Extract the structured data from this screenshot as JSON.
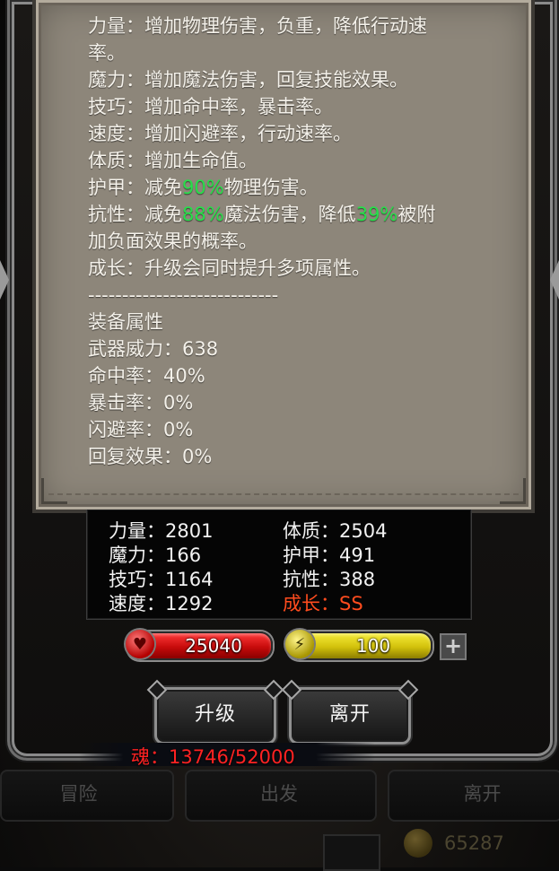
{
  "description": {
    "lines": [
      {
        "parts": [
          {
            "t": "力量：增加物理伤害，负重，降低行动速"
          }
        ]
      },
      {
        "parts": [
          {
            "t": "率。"
          }
        ]
      },
      {
        "parts": [
          {
            "t": "魔力：增加魔法伤害，回复技能效果。"
          }
        ]
      },
      {
        "parts": [
          {
            "t": "技巧：增加命中率，暴击率。"
          }
        ]
      },
      {
        "parts": [
          {
            "t": "速度：增加闪避率，行动速率。"
          }
        ]
      },
      {
        "parts": [
          {
            "t": "体质：增加生命值。"
          }
        ]
      },
      {
        "parts": [
          {
            "t": "护甲：减免"
          },
          {
            "t": "90%",
            "green": true
          },
          {
            "t": "物理伤害。"
          }
        ]
      },
      {
        "parts": [
          {
            "t": "抗性：减免"
          },
          {
            "t": "88%",
            "green": true
          },
          {
            "t": "魔法伤害，降低"
          },
          {
            "t": "39%",
            "green": true
          },
          {
            "t": "被附"
          }
        ]
      },
      {
        "parts": [
          {
            "t": "加负面效果的概率。"
          }
        ]
      },
      {
        "parts": [
          {
            "t": "成长：升级会同时提升多项属性。"
          }
        ]
      },
      {
        "parts": [
          {
            "t": "----------------------------"
          }
        ]
      },
      {
        "parts": [
          {
            "t": "装备属性"
          }
        ]
      },
      {
        "parts": [
          {
            "t": "武器威力：638"
          }
        ]
      },
      {
        "parts": [
          {
            "t": "命中率：40%"
          }
        ]
      },
      {
        "parts": [
          {
            "t": "暴击率：0%"
          }
        ]
      },
      {
        "parts": [
          {
            "t": "闪避率：0%"
          }
        ]
      },
      {
        "parts": [
          {
            "t": "回复效果：0%"
          }
        ]
      }
    ],
    "highlight_color": "#26e04a"
  },
  "stats": {
    "strength": "力量：2801",
    "magic": "魔力：166",
    "skill": "技巧：1164",
    "speed": "速度：1292",
    "constitution": "体质：2504",
    "armor": "护甲：491",
    "resistance": "抗性：388",
    "growth": "成长：SS",
    "growth_color": "#ff4c1e"
  },
  "resources": {
    "hp": "25040",
    "energy": "100",
    "hp_icon": "heart-icon",
    "energy_icon": "lightning-icon",
    "plus_icon": "plus-icon"
  },
  "buttons": {
    "upgrade": "升级",
    "leave": "离开"
  },
  "soul": {
    "text": "魂：13746/52000",
    "color": "#ff2222"
  },
  "background_menu": {
    "tab_adventure": "冒险",
    "tab_depart": "出发",
    "tab_leave": "离开",
    "gold": "65287",
    "gold_icon": "coin-icon"
  }
}
